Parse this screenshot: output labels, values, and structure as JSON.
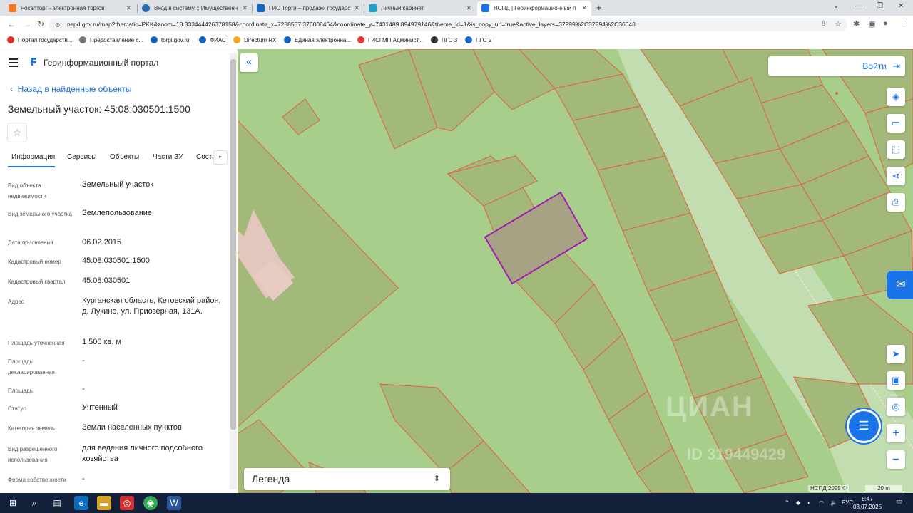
{
  "browser": {
    "tabs": [
      {
        "title": "Росэлторг - электронная торгов",
        "color": "#f47a20"
      },
      {
        "title": "Вход в систему :: Имущественн",
        "color": "#2b6cb0"
      },
      {
        "title": "ГИС Торги – продажи государст",
        "color": "#1565c0"
      },
      {
        "title": "Личный кабинет",
        "color": "#20a0c8"
      },
      {
        "title": "НСПД | Геоинформационный п",
        "color": "#1a73e8"
      }
    ],
    "new_tab": "+",
    "url": "nspd.gov.ru/map?thematic=PKK&zoom=18.333444426378158&coordinate_x=7288557.376008464&coordinate_y=7431489.894979146&theme_id=1&is_copy_url=true&active_layers=37299%2C37294%2C36048",
    "bookmarks": [
      {
        "label": "Портал государств...",
        "color": "#d93025"
      },
      {
        "label": "Предоставление с...",
        "color": "#555"
      },
      {
        "label": "torgi.gov.ru",
        "color": "#1565c0"
      },
      {
        "label": "ФИАС",
        "color": "#1565c0"
      },
      {
        "label": "Directum RX",
        "color": "#f6a821"
      },
      {
        "label": "Единая электронна...",
        "color": "#1565c0"
      },
      {
        "label": "ГИСГМП Админист...",
        "color": "#e53935"
      },
      {
        "label": "ПГС 3",
        "color": "#333"
      },
      {
        "label": "ПГС 2",
        "color": "#1565c0"
      }
    ]
  },
  "app": {
    "title": "Геоинформационный портал",
    "back_link": "Назад в найденные объекты",
    "object_title": "Земельный участок: 45:08:030501:1500",
    "tabs": [
      "Информация",
      "Сервисы",
      "Объекты",
      "Части ЗУ",
      "Соста"
    ],
    "properties": [
      {
        "label": "Вид объекта недвижимости",
        "value": "Земельный участок"
      },
      {
        "label": "Вид земельного участка",
        "value": "Землепользование"
      },
      {
        "label": "Дата присвоения",
        "value": "06.02.2015"
      },
      {
        "label": "Кадастровый номер",
        "value": "45:08:030501:1500"
      },
      {
        "label": "Кадастровый квартал",
        "value": "45:08:030501"
      },
      {
        "label": "Адрес",
        "value": "Курганская область, Кетовский район, д. Лукино, ул. Приозерная, 131А."
      },
      {
        "label": "Площадь уточненная",
        "value": "1 500 кв. м"
      },
      {
        "label": "Площадь декларированная",
        "value": "-"
      },
      {
        "label": "Площадь",
        "value": "-"
      },
      {
        "label": "Статус",
        "value": "Учтенный"
      },
      {
        "label": "Категория земель",
        "value": "Земли населенных пунктов"
      },
      {
        "label": "Вид разрешенного использования",
        "value": "для ведения личного подсобного хозяйства"
      },
      {
        "label": "Форма собственности",
        "value": "-"
      }
    ]
  },
  "map": {
    "login": "Войти",
    "legend": "Легенда",
    "watermark": "ЦИАН",
    "watermark_id": "ID 319449429",
    "copyright": "НСПД 2025 ©",
    "scale": "20 m",
    "colors": {
      "ground": "#a7cf8b",
      "parcel_fill": "#a2b97a",
      "parcel_stroke": "#e2603f",
      "selected_stroke": "#a21caf",
      "selected_fill": "#a8a285",
      "road": "#c2ddb0"
    }
  },
  "taskbar": {
    "time": "8:47",
    "date": "03.07.2025",
    "lang": "РУС"
  }
}
